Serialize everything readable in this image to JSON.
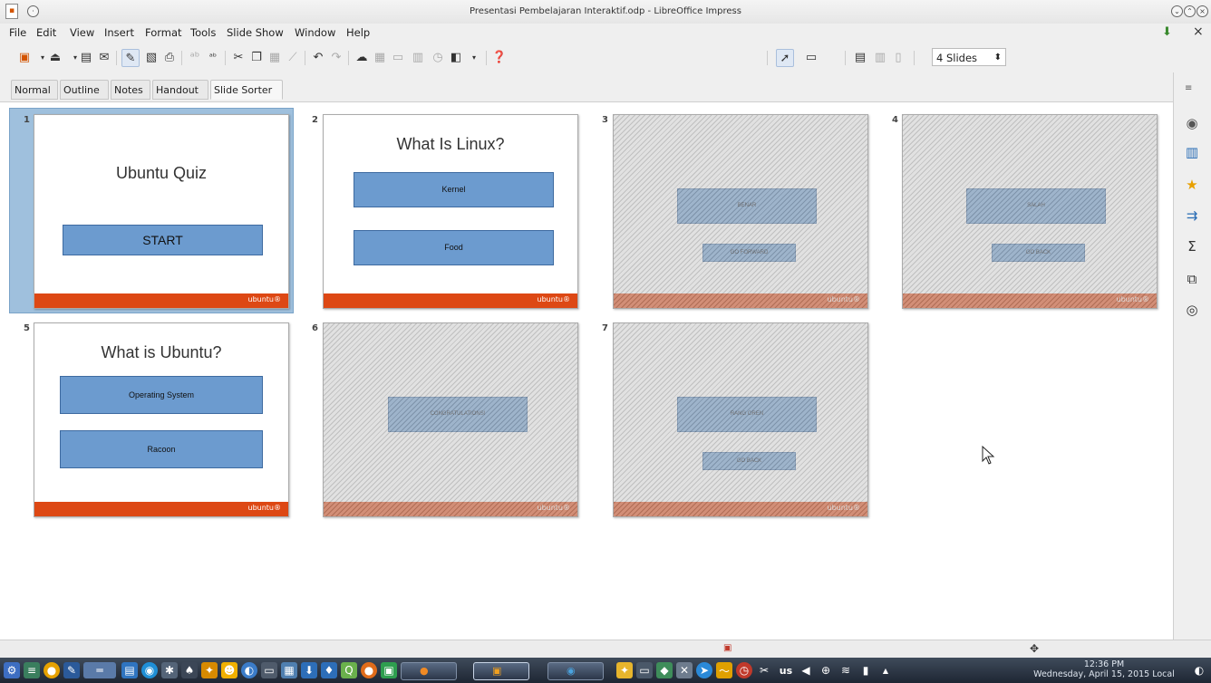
{
  "window": {
    "title": "Presentasi Pembelajaran Interaktif.odp - LibreOffice Impress"
  },
  "menu": [
    "File",
    "Edit",
    "View",
    "Insert",
    "Format",
    "Tools",
    "Slide Show",
    "Window",
    "Help"
  ],
  "toolbar": {
    "slides_per_row": "4 Slides"
  },
  "view_tabs": [
    "Normal",
    "Outline",
    "Notes",
    "Handout",
    "Slide Sorter"
  ],
  "active_tab": "Slide Sorter",
  "slides": [
    {
      "num": "1",
      "title": "Ubuntu Quiz",
      "buttons": [
        "START"
      ],
      "footer": "ubuntu®",
      "hidden": false
    },
    {
      "num": "2",
      "title": "What Is Linux?",
      "buttons": [
        "Kernel",
        "Food"
      ],
      "footer": "ubuntu®",
      "hidden": false
    },
    {
      "num": "3",
      "title": "",
      "buttons": [
        "BENAR",
        "GO FORWARD"
      ],
      "footer": "ubuntu®",
      "hidden": true
    },
    {
      "num": "4",
      "title": "",
      "buttons": [
        "SALAH",
        "GO BACK"
      ],
      "footer": "ubuntu®",
      "hidden": true
    },
    {
      "num": "5",
      "title": "What is Ubuntu?",
      "buttons": [
        "Operating System",
        "Racoon"
      ],
      "footer": "ubuntu®",
      "hidden": false
    },
    {
      "num": "6",
      "title": "",
      "buttons": [
        "CONGRATULATIONS!"
      ],
      "footer": "ubuntu®",
      "hidden": true
    },
    {
      "num": "7",
      "title": "",
      "buttons": [
        "RANG OREN",
        "GO BACK"
      ],
      "footer": "ubuntu®",
      "hidden": true
    }
  ],
  "taskbar": {
    "clock_time": "12:36 PM",
    "clock_date": "Wednesday, April 15, 2015 Local",
    "keyboard_layout": "us"
  },
  "colors": {
    "accent_orange": "#dd4814",
    "button_blue": "#6c9bcf",
    "selection": "#9fc0dd"
  }
}
